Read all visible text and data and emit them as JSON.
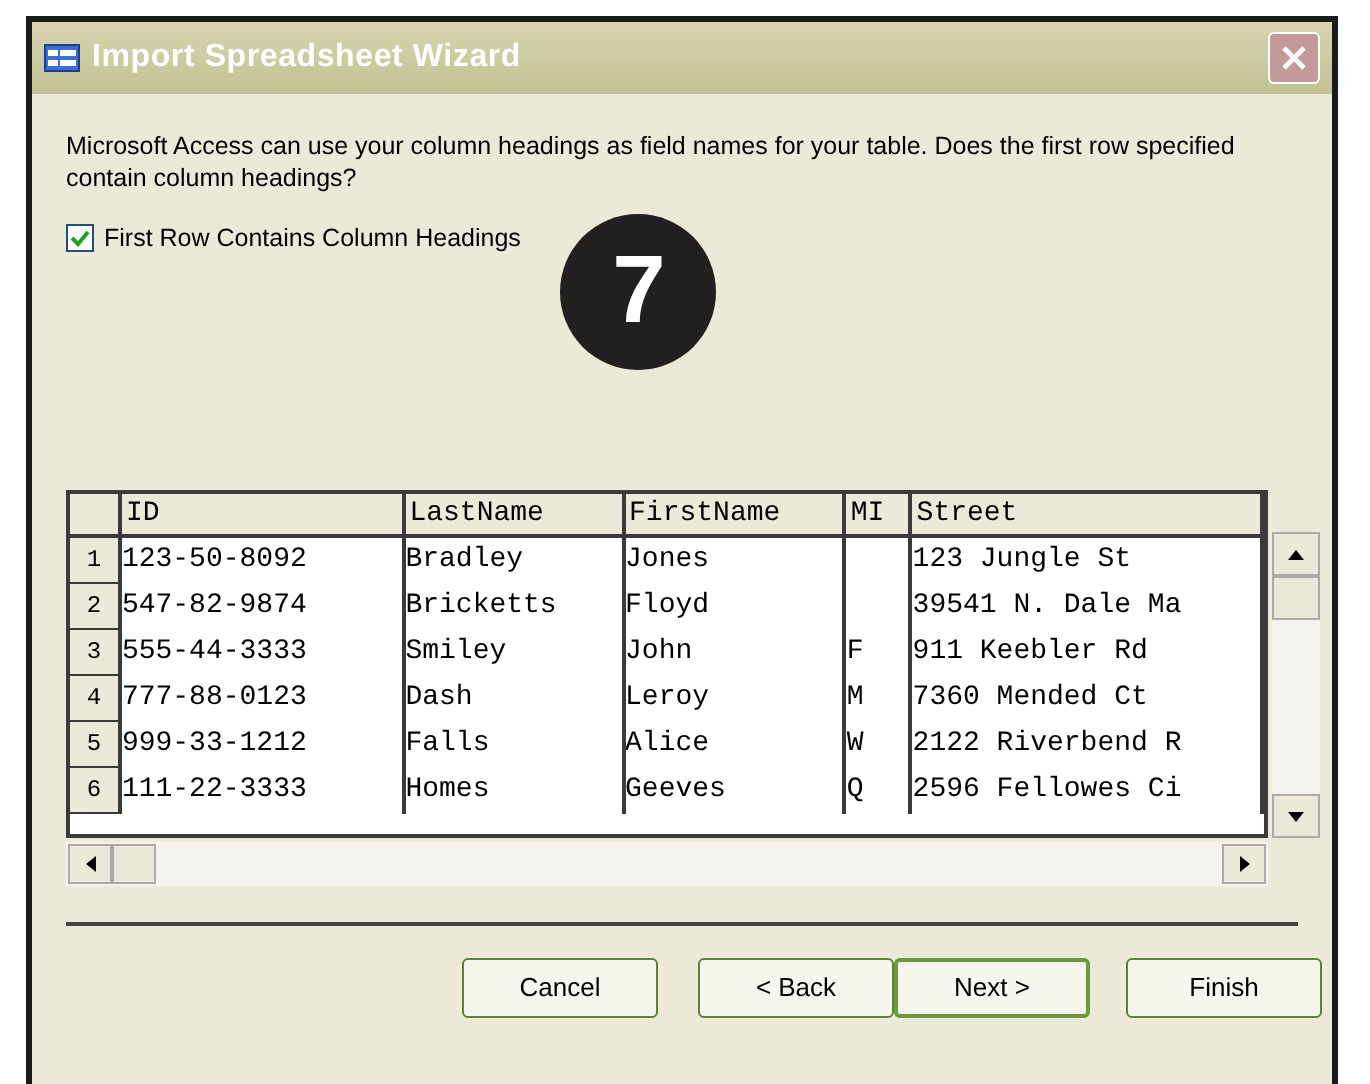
{
  "window": {
    "title": "Import Spreadsheet Wizard"
  },
  "prompt": "Microsoft Access can use your column headings as field names for your table. Does the first row specified contain column headings?",
  "checkbox": {
    "label": "First Row Contains Column Headings",
    "checked": true
  },
  "callout": {
    "number": "7"
  },
  "table": {
    "columns": [
      "ID",
      "LastName",
      "FirstName",
      "MI",
      "Street"
    ],
    "rows": [
      {
        "number": "1",
        "cells": [
          "123-50-8092",
          "Bradley",
          "Jones",
          "",
          "123 Jungle St"
        ]
      },
      {
        "number": "2",
        "cells": [
          "547-82-9874",
          "Bricketts",
          "Floyd",
          "",
          "39541 N. Dale Ma"
        ]
      },
      {
        "number": "3",
        "cells": [
          "555-44-3333",
          "Smiley",
          "John",
          "F",
          "911 Keebler Rd"
        ]
      },
      {
        "number": "4",
        "cells": [
          "777-88-0123",
          "Dash",
          "Leroy",
          "M",
          "7360 Mended Ct"
        ]
      },
      {
        "number": "5",
        "cells": [
          "999-33-1212",
          "Falls",
          "Alice",
          "W",
          "2122 Riverbend R"
        ]
      },
      {
        "number": "6",
        "cells": [
          "111-22-3333",
          "Homes",
          "Geeves",
          "Q",
          "2596 Fellowes Ci"
        ]
      }
    ]
  },
  "buttons": [
    {
      "label": "Cancel",
      "default": false
    },
    {
      "label": "< Back",
      "default": false
    },
    {
      "label": "Next >",
      "default": true
    },
    {
      "label": "Finish",
      "default": false
    }
  ]
}
